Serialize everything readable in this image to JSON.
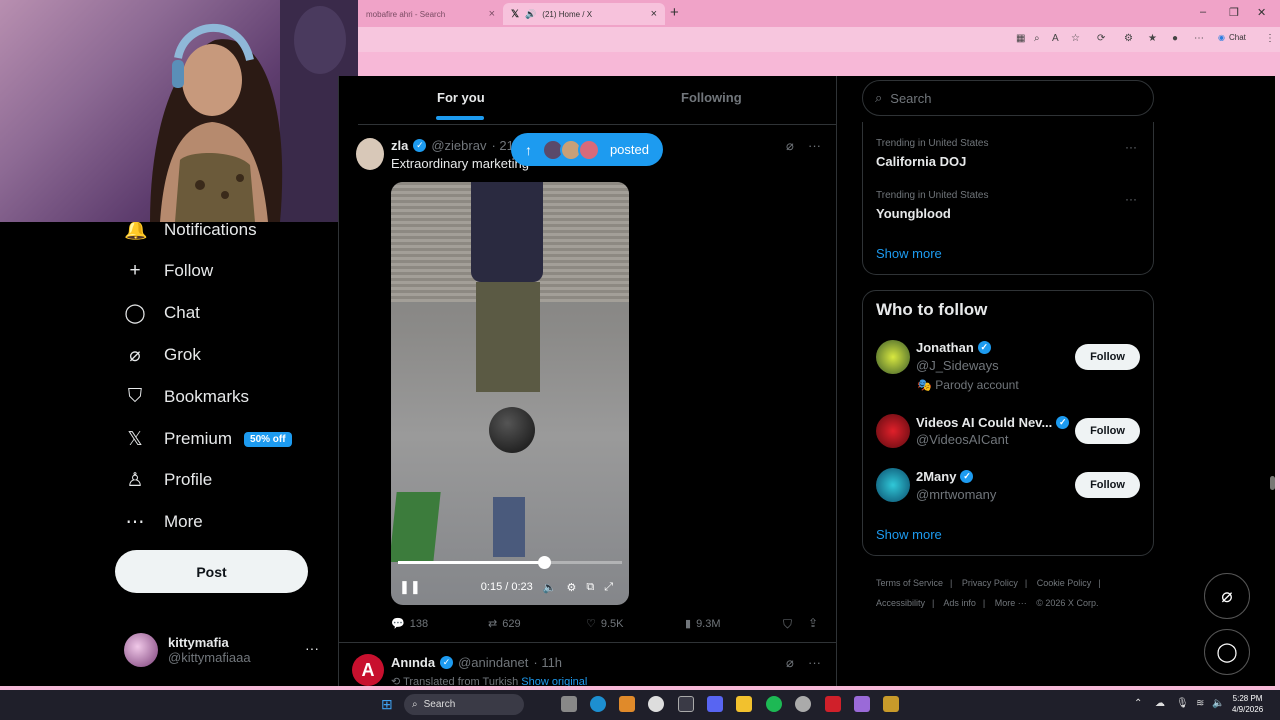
{
  "browser": {
    "tabs": [
      {
        "label": "mobafire ahri - Search",
        "close": "×"
      },
      {
        "label": "(21) Home / X",
        "close": "×"
      }
    ],
    "new_tab": "+",
    "window": {
      "minimize": "–",
      "restore": "❐",
      "close": "✕"
    },
    "chat_label": "Chat"
  },
  "sidebar": {
    "items": [
      {
        "label": "Notifications",
        "icon": "bell-icon",
        "glyph": "🔔"
      },
      {
        "label": "Follow",
        "icon": "follow-icon",
        "glyph": "👤"
      },
      {
        "label": "Chat",
        "icon": "chat-icon",
        "glyph": "💬"
      },
      {
        "label": "Grok",
        "icon": "grok-icon",
        "glyph": "⌀"
      },
      {
        "label": "Bookmarks",
        "icon": "bookmark-icon",
        "glyph": "🔖"
      },
      {
        "label": "Premium",
        "icon": "x-icon",
        "glyph": "𝕏"
      },
      {
        "label": "Profile",
        "icon": "profile-icon",
        "glyph": "👤"
      },
      {
        "label": "More",
        "icon": "more-icon",
        "glyph": "⋯"
      }
    ],
    "premium_badge": "50% off",
    "post_button": "Post",
    "account": {
      "name": "kittymafia",
      "handle": "@kittymafiaaa",
      "more": "···"
    }
  },
  "feed": {
    "tabs": {
      "for_you": "For you",
      "following": "Following"
    },
    "posted_pill": "posted",
    "post1": {
      "name": "zla",
      "handle": "@ziebrav",
      "time": "· 21h",
      "text": "Extraordinary marketing",
      "video": {
        "time": "0:15 / 0:23",
        "progress": 0.65
      },
      "replies": "138",
      "reposts": "629",
      "likes": "9.5K",
      "views": "9.3M"
    },
    "post2": {
      "name": "Anında",
      "handle": "@anindanet",
      "time": "· 11h",
      "translated": "Translated from Turkish",
      "show_original": "Show original"
    }
  },
  "right": {
    "search_placeholder": "Search",
    "trends": [
      {
        "meta": "Trending in United States",
        "name": "California DOJ"
      },
      {
        "meta": "Trending in United States",
        "name": "Youngblood"
      }
    ],
    "trends_show_more": "Show more",
    "who_to_follow": {
      "title": "Who to follow",
      "accounts": [
        {
          "name": "Jonathan",
          "handle": "@J_Sideways",
          "note": "Parody account"
        },
        {
          "name": "Videos AI Could Nev...",
          "handle": "@VideosAICant"
        },
        {
          "name": "2Many",
          "handle": "@mrtwomany"
        }
      ],
      "follow_label": "Follow",
      "show_more": "Show more"
    },
    "footer": [
      "Terms of Service",
      "|",
      "Privacy Policy",
      "|",
      "Cookie Policy",
      "|",
      "Accessibility",
      "|",
      "Ads info",
      "|",
      "More ···",
      "© 2026 X Corp."
    ]
  },
  "taskbar": {
    "search": "Search",
    "time": "5:28 PM",
    "date": "4/9/2026"
  }
}
